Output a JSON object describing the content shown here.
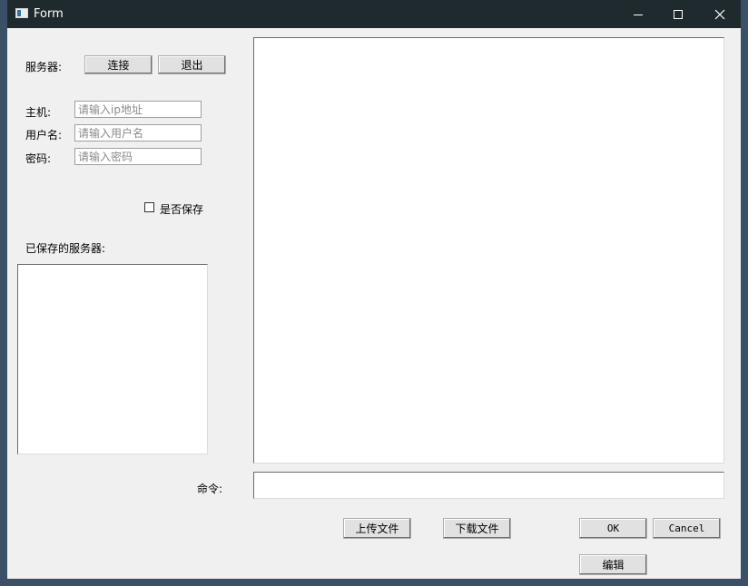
{
  "window": {
    "title": "Form"
  },
  "server": {
    "label": "服务器:",
    "connect_label": "连接",
    "exit_label": "退出"
  },
  "login": {
    "host_label": "主机:",
    "host_placeholder": "请输入ip地址",
    "host_value": "",
    "user_label": "用户名:",
    "user_placeholder": "请输入用户名",
    "user_value": "",
    "password_label": "密码:",
    "password_placeholder": "请输入密码",
    "password_value": ""
  },
  "save": {
    "checkbox_label": "是否保存",
    "checked": false
  },
  "saved_servers": {
    "label": "已保存的服务器:",
    "items": []
  },
  "output": {
    "content": ""
  },
  "command": {
    "label": "命令:",
    "value": ""
  },
  "actions": {
    "upload_label": "上传文件",
    "download_label": "下载文件",
    "ok_label": "OK",
    "cancel_label": "Cancel",
    "edit_label": "编辑"
  }
}
